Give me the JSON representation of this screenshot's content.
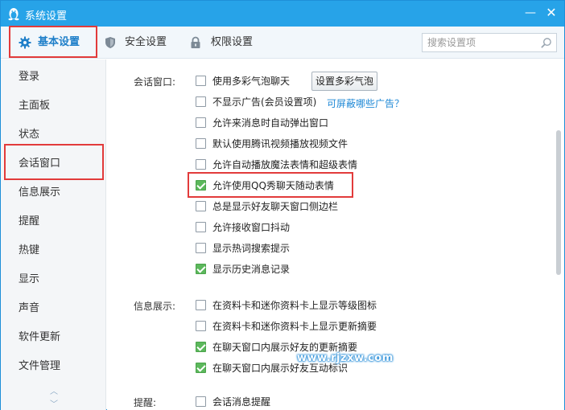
{
  "window": {
    "title": "系统设置",
    "minimize": "—",
    "close": "✕"
  },
  "tabs": [
    {
      "label": "基本设置",
      "icon": "gear-icon",
      "active": true
    },
    {
      "label": "安全设置",
      "icon": "shield-icon",
      "active": false
    },
    {
      "label": "权限设置",
      "icon": "lock-icon",
      "active": false
    }
  ],
  "search": {
    "placeholder": "搜索设置项",
    "value": ""
  },
  "sidebar": {
    "items": [
      "登录",
      "主面板",
      "状态",
      "会话窗口",
      "信息展示",
      "提醒",
      "热键",
      "显示",
      "声音",
      "软件更新",
      "文件管理"
    ],
    "selected": "会话窗口"
  },
  "sections": {
    "session": {
      "label": "会话窗口:",
      "options": [
        {
          "text": "使用多彩气泡聊天",
          "checked": false
        },
        {
          "text": "不显示广告(会员设置项)",
          "checked": false
        },
        {
          "text": "允许来消息时自动弹出窗口",
          "checked": false
        },
        {
          "text": "默认使用腾讯视频播放视频文件",
          "checked": false
        },
        {
          "text": "允许自动播放魔法表情和超级表情",
          "checked": false
        },
        {
          "text": "允许使用QQ秀聊天随动表情",
          "checked": true
        },
        {
          "text": "总是显示好友聊天窗口侧边栏",
          "checked": false
        },
        {
          "text": "允许接收窗口抖动",
          "checked": false
        },
        {
          "text": "显示热词搜索提示",
          "checked": false
        },
        {
          "text": "显示历史消息记录",
          "checked": true
        }
      ],
      "bubble_button": "设置多彩气泡",
      "ad_link": "可屏蔽哪些广告？"
    },
    "info": {
      "label": "信息展示:",
      "options": [
        {
          "text": "在资料卡和迷你资料卡上显示等级图标",
          "checked": false
        },
        {
          "text": "在资料卡和迷你资料卡上显示更新摘要",
          "checked": false
        },
        {
          "text": "在聊天窗口内展示好友的更新摘要",
          "checked": true
        },
        {
          "text": "在聊天窗口内展示好友互动标识",
          "checked": true
        }
      ]
    },
    "remind": {
      "label": "提醒:",
      "options": [
        {
          "text": "会话消息提醒",
          "checked": false
        }
      ]
    }
  },
  "watermark": "www.rjzxw.com",
  "colors": {
    "titlebar": "#27a3e8",
    "accent": "#1e7fc9",
    "check": "#5cb85c",
    "highlight": "#e23b3b",
    "link": "#1e88d6"
  }
}
